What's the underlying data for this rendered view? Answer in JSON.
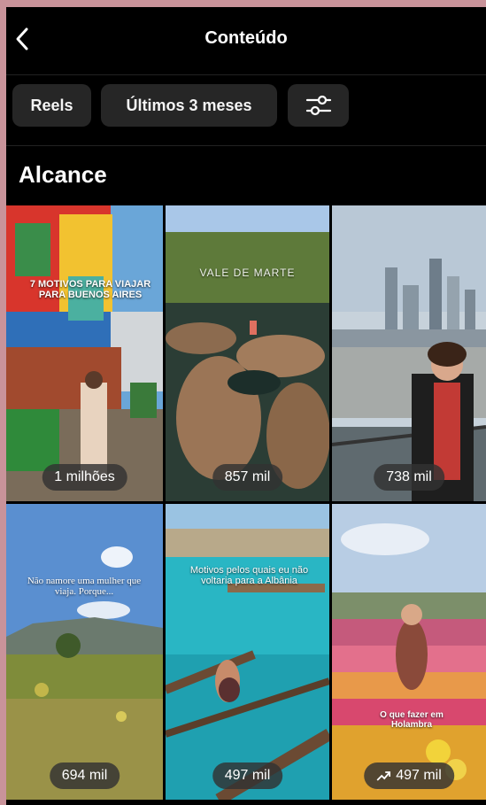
{
  "header": {
    "title": "Conteúdo"
  },
  "filters": {
    "type_label": "Reels",
    "period_label": "Últimos 3 meses"
  },
  "section": {
    "title": "Alcance"
  },
  "posts": [
    {
      "overlay": "7 MOTIVOS PARA VIAJAR PARA BUENOS AIRES",
      "reach": "1 milhões",
      "trending": false
    },
    {
      "overlay": "VALE DE MARTE",
      "reach": "857 mil",
      "trending": false
    },
    {
      "overlay": "",
      "reach": "738 mil",
      "trending": false
    },
    {
      "overlay": "Não namore uma mulher que viaja. Porque...",
      "reach": "694 mil",
      "trending": false
    },
    {
      "overlay": "Motivos pelos quais eu não voltaria para a Albânia",
      "reach": "497 mil",
      "trending": false
    },
    {
      "overlay": "O que fazer em Holambra",
      "reach": "497 mil",
      "trending": true
    }
  ],
  "colors": {
    "background": "#000000",
    "chip": "#262626",
    "badge": "#323232"
  },
  "icons": {
    "back": "chevron-left-icon",
    "filter": "sliders-icon",
    "trend": "trending-up-icon"
  }
}
